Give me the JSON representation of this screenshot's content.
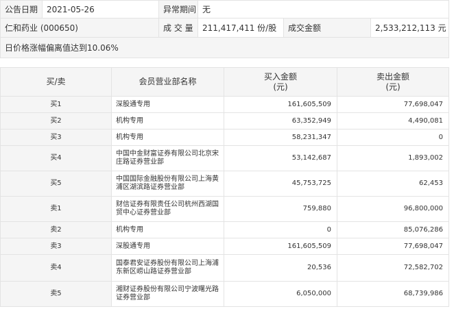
{
  "info": {
    "announce_date_label": "公告日期",
    "announce_date": "2021-05-26",
    "abnormal_period_label": "异常期间",
    "abnormal_period": "无",
    "stock": "仁和药业 (000650)",
    "volume_label": "成 交 量",
    "volume": "211,417,411 份/股",
    "amount_label": "成交金额",
    "amount": "2,533,212,113 元",
    "reason": "日价格涨幅偏离值达到10.06%"
  },
  "table": {
    "headers": {
      "side": "买/卖",
      "member": "会员营业部名称",
      "buy": "买入金额",
      "buy_unit": "(元)",
      "sell": "卖出金额",
      "sell_unit": "(元)"
    },
    "rows": [
      {
        "side": "买1",
        "name": "深股通专用",
        "buy": "161,605,509",
        "sell": "77,698,047"
      },
      {
        "side": "买2",
        "name": "机构专用",
        "buy": "63,352,949",
        "sell": "4,490,081"
      },
      {
        "side": "买3",
        "name": "机构专用",
        "buy": "58,231,347",
        "sell": "0"
      },
      {
        "side": "买4",
        "name": "中国中金财富证券有限公司北京宋庄路证券营业部",
        "buy": "53,142,687",
        "sell": "1,893,002"
      },
      {
        "side": "买5",
        "name": "中国国际金融股份有限公司上海黄浦区湖滨路证券营业部",
        "buy": "45,753,725",
        "sell": "62,453"
      },
      {
        "side": "卖1",
        "name": "财信证券有限责任公司杭州西湖国贸中心证券营业部",
        "buy": "759,880",
        "sell": "96,800,000"
      },
      {
        "side": "卖2",
        "name": "机构专用",
        "buy": "0",
        "sell": "85,076,286"
      },
      {
        "side": "卖3",
        "name": "深股通专用",
        "buy": "161,605,509",
        "sell": "77,698,047"
      },
      {
        "side": "卖4",
        "name": "国泰君安证券股份有限公司上海浦东新区崂山路证券营业部",
        "buy": "20,536",
        "sell": "72,582,702"
      },
      {
        "side": "卖5",
        "name": "湘财证券股份有限公司宁波曙光路证券营业部",
        "buy": "6,050,000",
        "sell": "68,739,986"
      }
    ]
  }
}
